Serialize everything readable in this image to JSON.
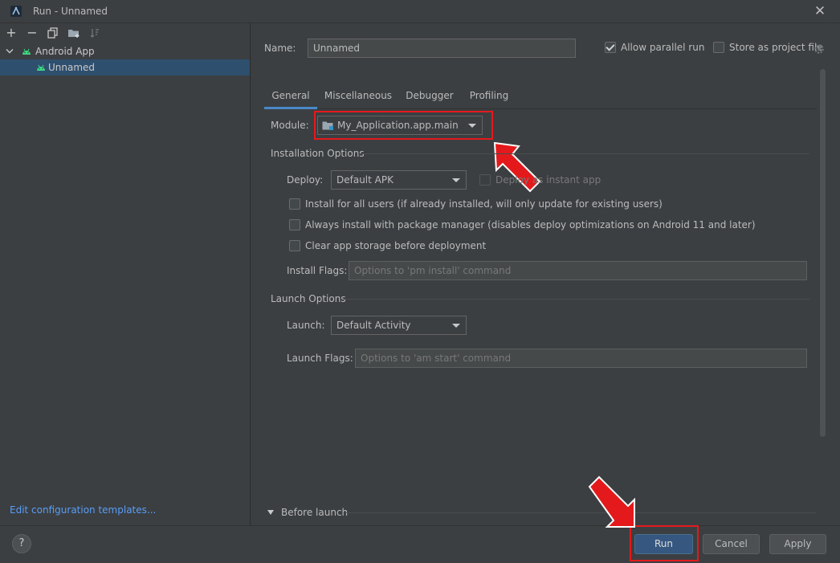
{
  "window": {
    "title": "Run - Unnamed",
    "close_glyph": "✕"
  },
  "left_toolbar": {
    "add_glyph": "+",
    "remove_glyph": "−"
  },
  "tree": {
    "group_label": "Android App",
    "config_label": "Unnamed"
  },
  "edit_templates_link": "Edit configuration templates...",
  "name_field": {
    "label": "Name:",
    "value": "Unnamed"
  },
  "allow_parallel_run": {
    "label": "Allow parallel run",
    "checked": true
  },
  "store_as_project_file": {
    "label": "Store as project file",
    "checked": false
  },
  "tabs": [
    {
      "label": "General",
      "active": true
    },
    {
      "label": "Miscellaneous",
      "active": false
    },
    {
      "label": "Debugger",
      "active": false
    },
    {
      "label": "Profiling",
      "active": false
    }
  ],
  "module": {
    "label": "Module:",
    "value": "My_Application.app.main"
  },
  "installation_options": {
    "title": "Installation Options",
    "deploy_label": "Deploy:",
    "deploy_value": "Default APK",
    "deploy_instant_label": "Deploy as instant app",
    "install_all_users": "Install for all users (if already installed, will only update for existing users)",
    "always_install_pm": "Always install with package manager (disables deploy optimizations on Android 11 and later)",
    "clear_storage": "Clear app storage before deployment",
    "install_flags_label": "Install Flags:",
    "install_flags_placeholder": "Options to 'pm install' command"
  },
  "launch_options": {
    "title": "Launch Options",
    "launch_label": "Launch:",
    "launch_value": "Default Activity",
    "launch_flags_label": "Launch Flags:",
    "launch_flags_placeholder": "Options to 'am start' command"
  },
  "before_launch": {
    "label": "Before launch"
  },
  "buttons": {
    "help": "?",
    "run": "Run",
    "cancel": "Cancel",
    "apply": "Apply"
  },
  "colors": {
    "background": "#3c3f41",
    "selection": "#2f4f6f",
    "accent_link": "#589df6",
    "primary_button": "#365880",
    "annotation_red": "#e3191b",
    "android_green": "#3ddc84"
  }
}
